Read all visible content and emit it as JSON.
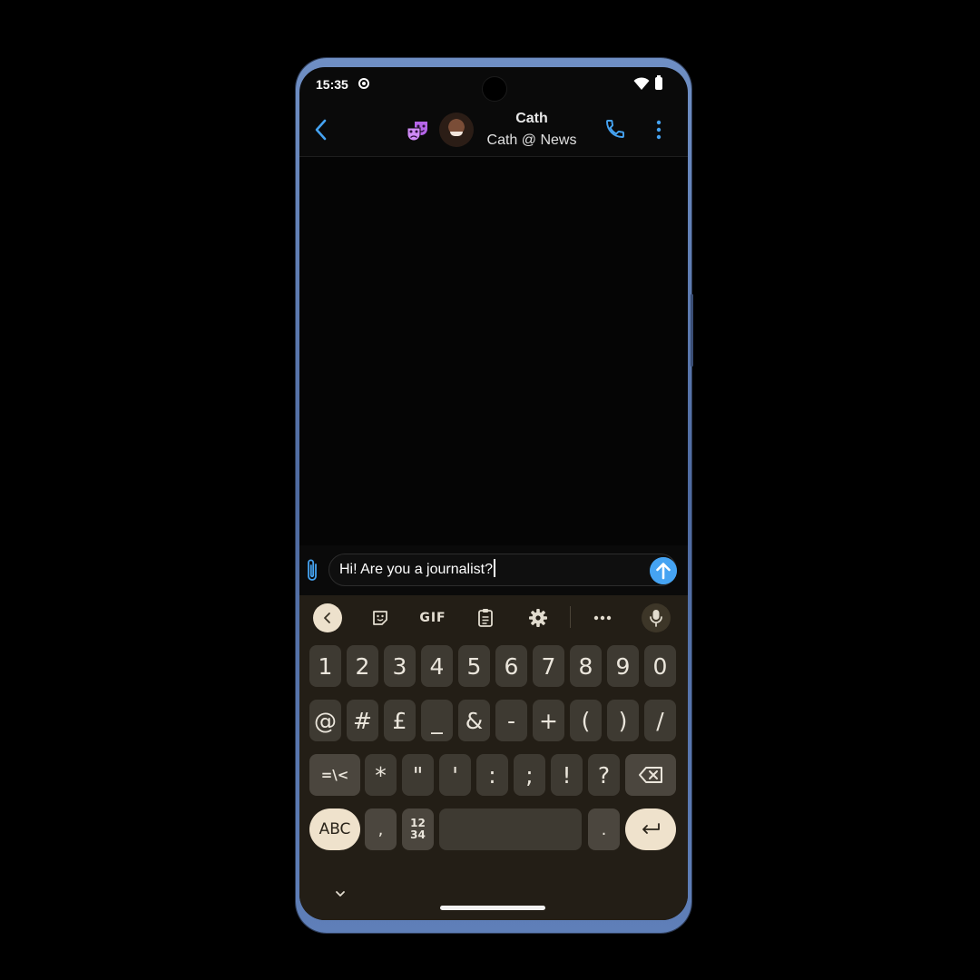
{
  "status_bar": {
    "time": "15:35"
  },
  "chat_header": {
    "contact_name": "Cath",
    "contact_subtitle": "Cath @ News"
  },
  "composer": {
    "message_text": "Hi! Are you a journalist?"
  },
  "keyboard": {
    "toolbar": {
      "gif_label": "GIF"
    },
    "rows": {
      "digits": [
        "1",
        "2",
        "3",
        "4",
        "5",
        "6",
        "7",
        "8",
        "9",
        "0"
      ],
      "symbols_1": [
        "@",
        "#",
        "£",
        "_",
        "&",
        "-",
        "+",
        "(",
        ")",
        "/"
      ],
      "symbols_2": [
        "=\\<",
        "*",
        "\"",
        "'",
        ":",
        ";",
        "!",
        "?"
      ]
    },
    "bottom_row": {
      "abc_label": "ABC",
      "comma": ",",
      "fraction_top": "12",
      "fraction_bottom": "34",
      "period": "."
    }
  },
  "colors": {
    "accent_blue": "#45a3f2",
    "keyboard_bg": "#231e16",
    "key_bg": "#3e3a32",
    "pill_key_bg": "#efe2cc",
    "theatre_purple": "#b565e8"
  }
}
